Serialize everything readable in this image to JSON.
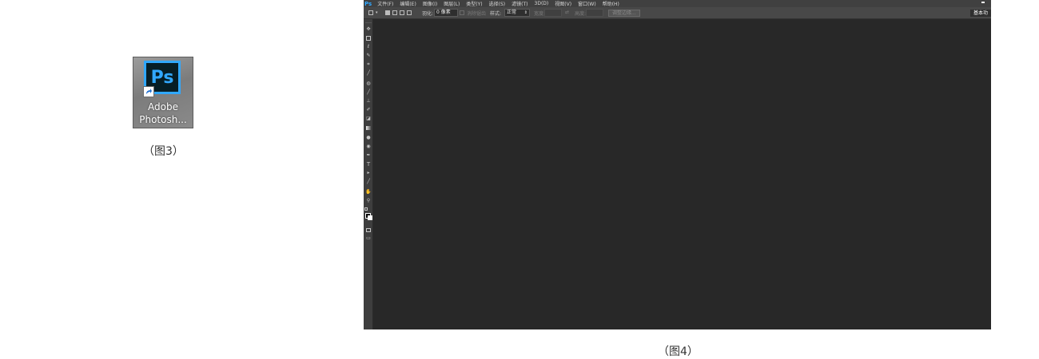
{
  "figure3": {
    "icon_text": "Ps",
    "label_line1": "Adobe",
    "label_line2": "Photosh...",
    "caption": "（图3）"
  },
  "figure4": {
    "app_logo": "Ps",
    "menu": [
      "文件(F)",
      "编辑(E)",
      "图像(I)",
      "图层(L)",
      "类型(Y)",
      "选择(S)",
      "滤镜(T)",
      "3D(D)",
      "视图(V)",
      "窗口(W)",
      "帮助(H)"
    ],
    "options": {
      "feather_label": "羽化:",
      "feather_value": "0 像素",
      "antialias_label": "消除锯齿",
      "style_label": "样式:",
      "style_value": "正常",
      "width_label": "宽度:",
      "height_label": "高度:",
      "refine_edge": "调整边缘...",
      "workspace": "基本功"
    },
    "tools": [
      "move-tool",
      "marquee-tool",
      "lasso-tool",
      "quick-select-tool",
      "crop-tool",
      "eyedropper-tool",
      "spot-heal-tool",
      "brush-tool",
      "clone-stamp-tool",
      "history-brush-tool",
      "eraser-tool",
      "gradient-tool",
      "blur-tool",
      "dodge-tool",
      "pen-tool",
      "type-tool",
      "path-select-tool",
      "line-tool",
      "hand-tool",
      "zoom-tool"
    ],
    "type_tool_glyph": "T",
    "caption": "（图4）",
    "colors": {
      "menubar": "#404040",
      "optionsbar": "#484848",
      "canvas": "#282828",
      "ps_blue": "#31a8ff"
    }
  }
}
